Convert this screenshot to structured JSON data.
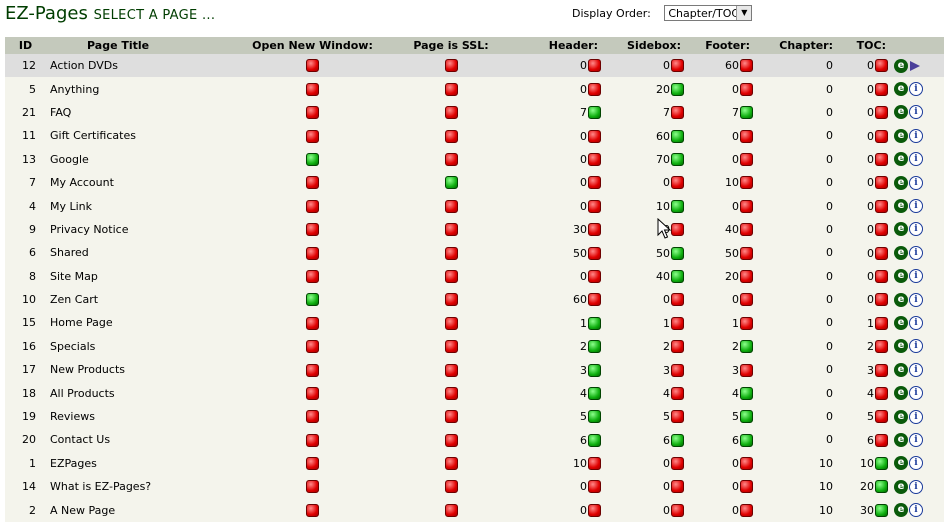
{
  "header": {
    "title_main": "EZ-Pages",
    "title_rest": "Select a page ...",
    "display_order_label": "Display Order:",
    "display_order_value": "Chapter/TOC"
  },
  "columns": {
    "id": "ID",
    "page_title": "Page Title",
    "open_new_window": "Open New Window:",
    "page_is_ssl": "Page is SSL:",
    "header": "Header:",
    "sidebox": "Sidebox:",
    "footer": "Footer:",
    "chapter": "Chapter:",
    "toc": "TOC:"
  },
  "colors": {
    "status_on": "#10b010",
    "status_off": "#e00000",
    "title_color": "#003d00",
    "header_row_bg": "#c4c9bc",
    "selected_row_bg": "#dedede"
  },
  "rows": [
    {
      "id": "12",
      "title": "Action DVDs",
      "new_window": "off",
      "ssl": "off",
      "header": "0",
      "header_on": "off",
      "sidebox": "0",
      "sidebox_on": "off",
      "footer": "60",
      "footer_on": "off",
      "chapter": "0",
      "toc": "0",
      "toc_on": "off",
      "selected": true
    },
    {
      "id": "5",
      "title": "Anything",
      "new_window": "off",
      "ssl": "off",
      "header": "0",
      "header_on": "off",
      "sidebox": "20",
      "sidebox_on": "on",
      "footer": "0",
      "footer_on": "off",
      "chapter": "0",
      "toc": "0",
      "toc_on": "off"
    },
    {
      "id": "21",
      "title": "FAQ",
      "new_window": "off",
      "ssl": "off",
      "header": "7",
      "header_on": "on",
      "sidebox": "7",
      "sidebox_on": "off",
      "footer": "7",
      "footer_on": "on",
      "chapter": "0",
      "toc": "0",
      "toc_on": "off"
    },
    {
      "id": "11",
      "title": "Gift Certificates",
      "new_window": "off",
      "ssl": "off",
      "header": "0",
      "header_on": "off",
      "sidebox": "60",
      "sidebox_on": "on",
      "footer": "0",
      "footer_on": "off",
      "chapter": "0",
      "toc": "0",
      "toc_on": "off"
    },
    {
      "id": "13",
      "title": "Google",
      "new_window": "on",
      "ssl": "off",
      "header": "0",
      "header_on": "off",
      "sidebox": "70",
      "sidebox_on": "on",
      "footer": "0",
      "footer_on": "off",
      "chapter": "0",
      "toc": "0",
      "toc_on": "off"
    },
    {
      "id": "7",
      "title": "My Account",
      "new_window": "off",
      "ssl": "on",
      "header": "0",
      "header_on": "off",
      "sidebox": "0",
      "sidebox_on": "off",
      "footer": "10",
      "footer_on": "off",
      "chapter": "0",
      "toc": "0",
      "toc_on": "off"
    },
    {
      "id": "4",
      "title": "My Link",
      "new_window": "off",
      "ssl": "off",
      "header": "0",
      "header_on": "off",
      "sidebox": "10",
      "sidebox_on": "on",
      "footer": "0",
      "footer_on": "off",
      "chapter": "0",
      "toc": "0",
      "toc_on": "off"
    },
    {
      "id": "9",
      "title": "Privacy Notice",
      "new_window": "off",
      "ssl": "off",
      "header": "30",
      "header_on": "off",
      "sidebox": "0",
      "sidebox_on": "off",
      "footer": "40",
      "footer_on": "off",
      "chapter": "0",
      "toc": "0",
      "toc_on": "off"
    },
    {
      "id": "6",
      "title": "Shared",
      "new_window": "off",
      "ssl": "off",
      "header": "50",
      "header_on": "off",
      "sidebox": "50",
      "sidebox_on": "on",
      "footer": "50",
      "footer_on": "off",
      "chapter": "0",
      "toc": "0",
      "toc_on": "off"
    },
    {
      "id": "8",
      "title": "Site Map",
      "new_window": "off",
      "ssl": "off",
      "header": "0",
      "header_on": "off",
      "sidebox": "40",
      "sidebox_on": "on",
      "footer": "20",
      "footer_on": "off",
      "chapter": "0",
      "toc": "0",
      "toc_on": "off"
    },
    {
      "id": "10",
      "title": "Zen Cart",
      "new_window": "on",
      "ssl": "off",
      "header": "60",
      "header_on": "off",
      "sidebox": "0",
      "sidebox_on": "off",
      "footer": "0",
      "footer_on": "off",
      "chapter": "0",
      "toc": "0",
      "toc_on": "off"
    },
    {
      "id": "15",
      "title": "Home Page",
      "new_window": "off",
      "ssl": "off",
      "header": "1",
      "header_on": "on",
      "sidebox": "1",
      "sidebox_on": "off",
      "footer": "1",
      "footer_on": "off",
      "chapter": "0",
      "toc": "1",
      "toc_on": "off"
    },
    {
      "id": "16",
      "title": "Specials",
      "new_window": "off",
      "ssl": "off",
      "header": "2",
      "header_on": "on",
      "sidebox": "2",
      "sidebox_on": "off",
      "footer": "2",
      "footer_on": "on",
      "chapter": "0",
      "toc": "2",
      "toc_on": "off"
    },
    {
      "id": "17",
      "title": "New Products",
      "new_window": "off",
      "ssl": "off",
      "header": "3",
      "header_on": "on",
      "sidebox": "3",
      "sidebox_on": "off",
      "footer": "3",
      "footer_on": "off",
      "chapter": "0",
      "toc": "3",
      "toc_on": "off"
    },
    {
      "id": "18",
      "title": "All Products",
      "new_window": "off",
      "ssl": "off",
      "header": "4",
      "header_on": "on",
      "sidebox": "4",
      "sidebox_on": "off",
      "footer": "4",
      "footer_on": "on",
      "chapter": "0",
      "toc": "4",
      "toc_on": "off"
    },
    {
      "id": "19",
      "title": "Reviews",
      "new_window": "off",
      "ssl": "off",
      "header": "5",
      "header_on": "on",
      "sidebox": "5",
      "sidebox_on": "off",
      "footer": "5",
      "footer_on": "on",
      "chapter": "0",
      "toc": "5",
      "toc_on": "off"
    },
    {
      "id": "20",
      "title": "Contact Us",
      "new_window": "off",
      "ssl": "off",
      "header": "6",
      "header_on": "on",
      "sidebox": "6",
      "sidebox_on": "on",
      "footer": "6",
      "footer_on": "on",
      "chapter": "0",
      "toc": "6",
      "toc_on": "off"
    },
    {
      "id": "1",
      "title": "EZPages",
      "new_window": "off",
      "ssl": "off",
      "header": "10",
      "header_on": "off",
      "sidebox": "0",
      "sidebox_on": "off",
      "footer": "0",
      "footer_on": "off",
      "chapter": "10",
      "toc": "10",
      "toc_on": "on"
    },
    {
      "id": "14",
      "title": "What is EZ-Pages?",
      "new_window": "off",
      "ssl": "off",
      "header": "0",
      "header_on": "off",
      "sidebox": "0",
      "sidebox_on": "off",
      "footer": "0",
      "footer_on": "off",
      "chapter": "10",
      "toc": "20",
      "toc_on": "on"
    },
    {
      "id": "2",
      "title": "A New Page",
      "new_window": "off",
      "ssl": "off",
      "header": "0",
      "header_on": "off",
      "sidebox": "0",
      "sidebox_on": "off",
      "footer": "0",
      "footer_on": "off",
      "chapter": "10",
      "toc": "30",
      "toc_on": "on"
    }
  ],
  "icons": {
    "edit": "edit-icon",
    "info": "info-icon",
    "selected_marker": "arrow-right-icon",
    "status_on": "green-status-icon",
    "status_off": "red-status-icon"
  },
  "glyphs": {
    "edit_letter": "e",
    "info_letter": "i",
    "select_arrow": "▼"
  }
}
